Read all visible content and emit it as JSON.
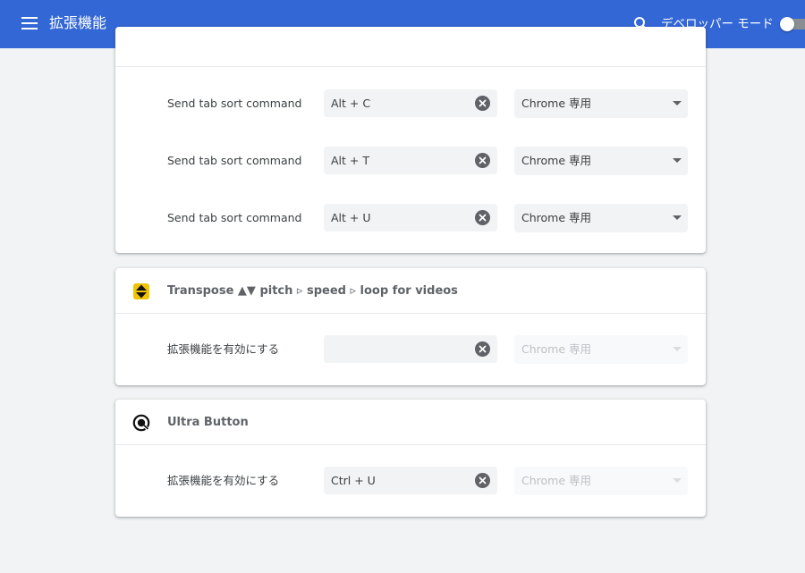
{
  "toolbar": {
    "title": "拡張機能",
    "developer_mode_label": "デベロッパー モード",
    "developer_mode_on": false
  },
  "colors": {
    "toolbar_bg": "#3367d6",
    "page_bg": "#f1f3f4",
    "field_bg": "#f1f3f4",
    "disabled_text": "#bdc1c6"
  },
  "icons": {
    "menu": "hamburger-menu-icon",
    "search": "search-icon",
    "clear": "clear-circle-x-icon",
    "dropdown": "caret-down-icon",
    "transpose": "transpose-up-down-arrows-icon",
    "ultra_button": "ultra-button-logo-icon"
  },
  "cards": [
    {
      "name": "",
      "shortcuts": [
        {
          "label": "Send tab sort command",
          "value": "Alt + C",
          "scope": "Chrome 専用",
          "scope_enabled": true
        },
        {
          "label": "Send tab sort command",
          "value": "Alt + T",
          "scope": "Chrome 専用",
          "scope_enabled": true
        },
        {
          "label": "Send tab sort command",
          "value": "Alt + U",
          "scope": "Chrome 専用",
          "scope_enabled": true
        }
      ]
    },
    {
      "name": "Transpose ▲▼ pitch ▹ speed ▹ loop for videos",
      "shortcuts": [
        {
          "label": "拡張機能を有効にする",
          "value": "",
          "scope": "Chrome 専用",
          "scope_enabled": false
        }
      ]
    },
    {
      "name": "Ultra Button",
      "shortcuts": [
        {
          "label": "拡張機能を有効にする",
          "value": "Ctrl + U",
          "scope": "Chrome 専用",
          "scope_enabled": false
        }
      ]
    }
  ]
}
